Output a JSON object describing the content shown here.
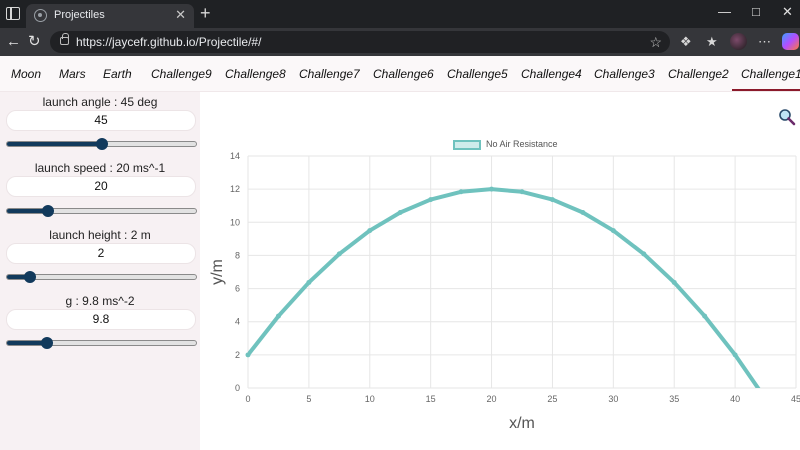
{
  "browser": {
    "tab_title": "Projectiles",
    "tab_close": "✕",
    "new_tab": "+",
    "url": "https://jaycefr.github.io/Projectile/#/",
    "icons": [
      "window-icon",
      "back-icon",
      "reload-icon",
      "lock-icon",
      "star-icon",
      "extensions-icon",
      "favorites-icon",
      "profile-icon",
      "more-icon",
      "copilot-icon",
      "minimize-icon",
      "maximize-icon",
      "close-icon"
    ]
  },
  "nav": {
    "items": [
      "Moon",
      "Mars",
      "Earth",
      "Challenge9",
      "Challenge8",
      "Challenge7",
      "Challenge6",
      "Challenge5",
      "Challenge4",
      "Challenge3",
      "Challenge2",
      "Challenge1"
    ],
    "active": "Challenge1",
    "accent": "#8b1a2b"
  },
  "controls": {
    "angle": {
      "label": "launch angle : 45 deg",
      "value": "45",
      "min": 0,
      "max": 90,
      "current": 45
    },
    "speed": {
      "label": "launch speed : 20 ms^-1",
      "value": "20",
      "min": 0,
      "max": 100,
      "current": 20
    },
    "height": {
      "label": "launch height : 2 m",
      "value": "2",
      "min": 0,
      "max": 20,
      "current": 2
    },
    "gravity": {
      "label": "g : 9.8 ms^-2",
      "value": "9.8",
      "min": 0,
      "max": 50,
      "current": 9.8
    },
    "slider_color": "#123a5c"
  },
  "chart_data": {
    "type": "line",
    "legend": [
      "No Air Resistance"
    ],
    "legend_position": "top-center",
    "xlabel": "x/m",
    "ylabel": "y/m",
    "xlim": [
      0,
      45
    ],
    "ylim": [
      0,
      14
    ],
    "x_ticks": [
      "0",
      "5",
      "10",
      "15",
      "20",
      "25",
      "30",
      "35",
      "40",
      "45"
    ],
    "y_ticks": [
      "0",
      "2",
      "4",
      "6",
      "8",
      "10",
      "12",
      "14"
    ],
    "grid": true,
    "series_color": "#6fc2be",
    "series": [
      {
        "name": "No Air Resistance",
        "x": [
          0,
          2.5,
          5,
          7.5,
          10,
          12.5,
          15,
          17.5,
          20,
          22.5,
          25,
          27.5,
          30,
          32.5,
          35,
          37.5,
          40,
          42.5,
          42.7
        ],
        "y": [
          2.0,
          4.34,
          6.37,
          8.09,
          9.5,
          10.59,
          11.37,
          11.84,
          12.0,
          11.84,
          11.37,
          10.59,
          9.5,
          8.09,
          6.37,
          4.34,
          2.0,
          -0.66,
          -1.0
        ]
      }
    ]
  }
}
